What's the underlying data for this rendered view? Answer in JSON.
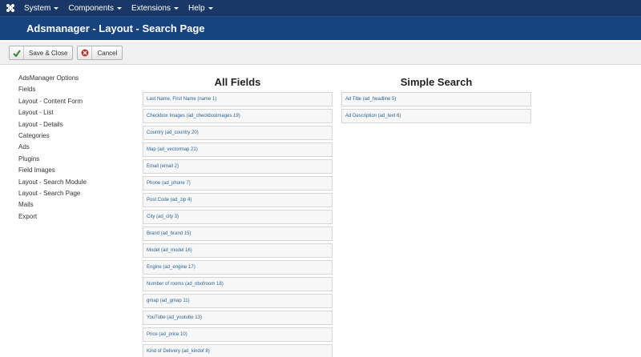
{
  "menu": {
    "items": [
      {
        "label": "System"
      },
      {
        "label": "Components"
      },
      {
        "label": "Extensions"
      },
      {
        "label": "Help"
      }
    ]
  },
  "header": {
    "title": "Adsmanager - Layout - Search Page"
  },
  "toolbar": {
    "save_close_label": "Save & Close",
    "cancel_label": "Cancel",
    "save_icon": "check-icon",
    "cancel_icon": "cancel-circle-icon",
    "colors": {
      "save_icon": "#378137",
      "cancel_icon": "#bd362f"
    }
  },
  "sidebar": {
    "items": [
      {
        "label": "AdsManager Options"
      },
      {
        "label": "Fields"
      },
      {
        "label": "Layout - Content Form"
      },
      {
        "label": "Layout - List"
      },
      {
        "label": "Layout - Details"
      },
      {
        "label": "Categories"
      },
      {
        "label": "Ads"
      },
      {
        "label": "Plugins"
      },
      {
        "label": "Field Images"
      },
      {
        "label": "Layout - Search Module"
      },
      {
        "label": "Layout - Search Page"
      },
      {
        "label": "Mails"
      },
      {
        "label": "Export"
      }
    ]
  },
  "all_fields": {
    "title": "All Fields",
    "fields": [
      "Last Name, First Name (name 1)",
      "Checkbox Images (ad_checkboximages 19)",
      "Country (ad_country 20)",
      "Map (ad_vectormap 21)",
      "Email (email 2)",
      "Phone (ad_phone 7)",
      "Post Code (ad_zip 4)",
      "City (ad_city 3)",
      "Brand (ad_brand 15)",
      "Model (ad_model 16)",
      "Engine (ad_engine 17)",
      "Number of rooms (ad_nbofroom 18)",
      "gmap (ad_gmap 11)",
      "YouTube (ad_youtube 13)",
      "Price (ad_price 10)",
      "Kind of Delivery (ad_kindof 8)"
    ]
  },
  "simple_search": {
    "title": "Simple Search",
    "fields": [
      "Ad Title (ad_headline 5)",
      "Ad Description (ad_text 6)"
    ]
  }
}
